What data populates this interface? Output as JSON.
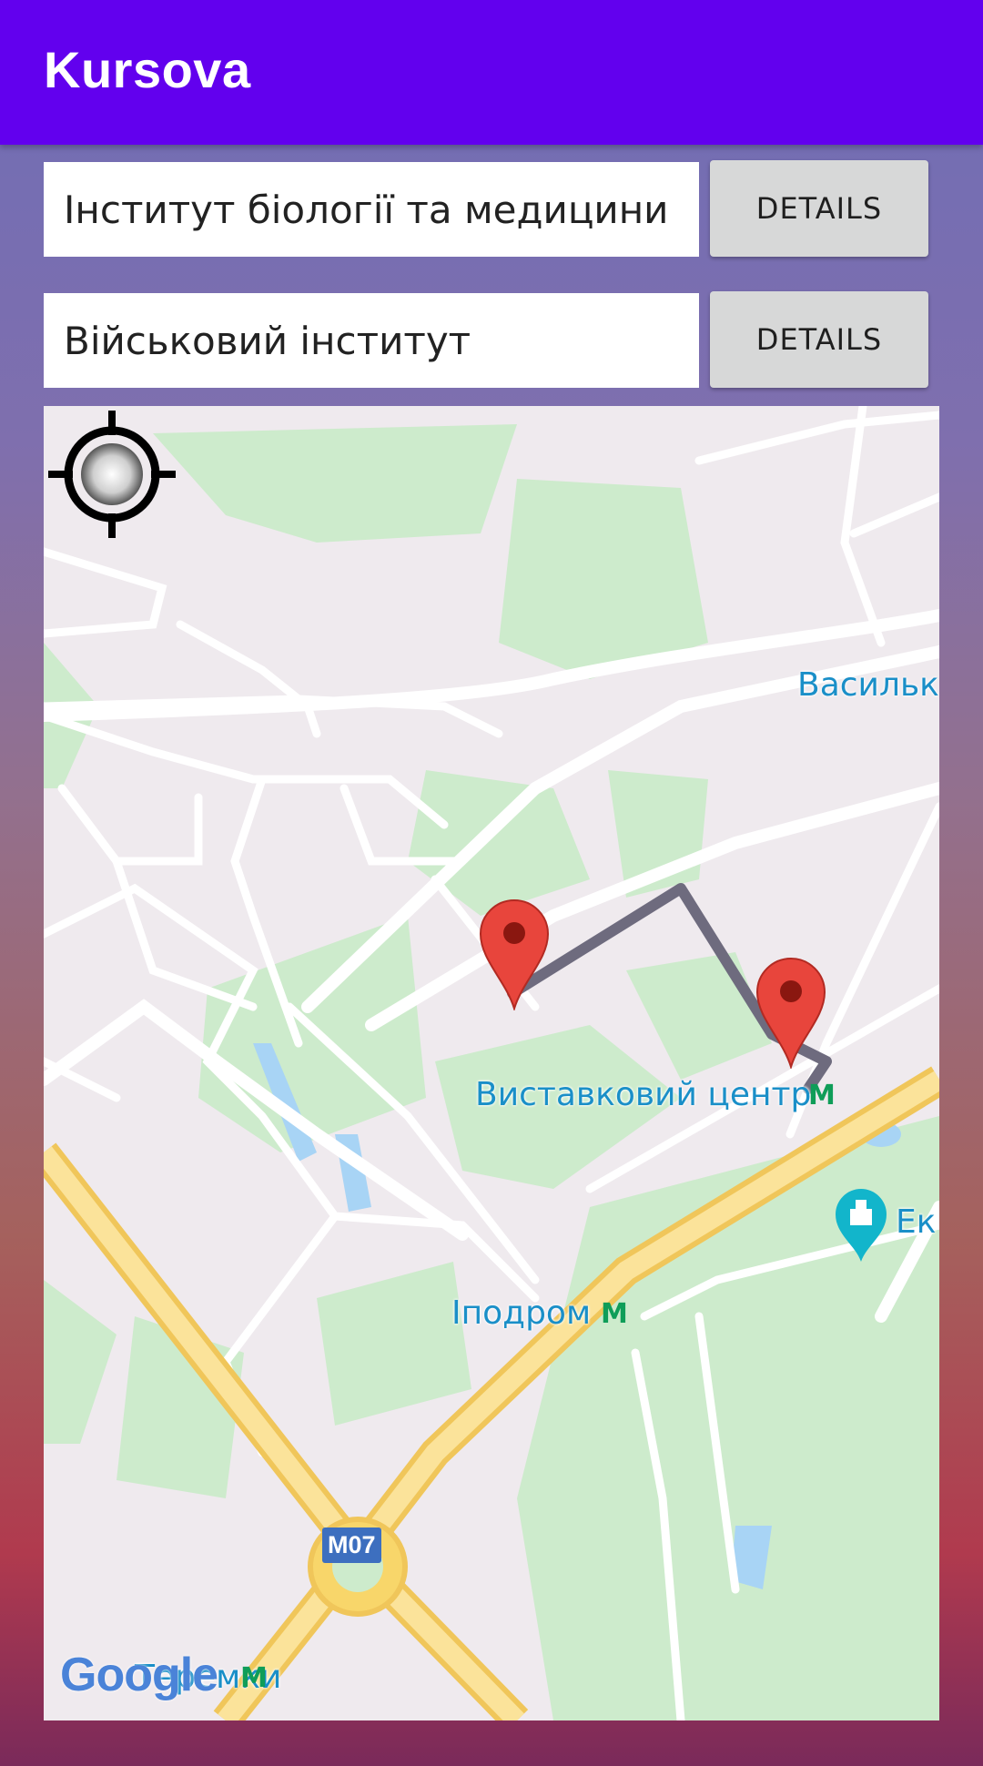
{
  "app": {
    "title": "Kursova"
  },
  "origin": {
    "value": "Інститут біології та медицини",
    "details_label": "DETAILS"
  },
  "destination": {
    "value": "Військовий інститут",
    "details_label": "DETAILS"
  },
  "map": {
    "labels": {
      "vasylkivska": "Васильківська",
      "vystavkovyi": "Виставковий центр",
      "ipodrom": "Іподром",
      "teremky": "Теремки",
      "ekspo": "Ек"
    },
    "metro_symbol": "M",
    "road_badge": "M07",
    "logo": "Google",
    "colors": {
      "pin": "#e8453c",
      "route": "#6e6b7e",
      "park": "#cdebcc",
      "highway": "#f8d66a",
      "water": "#a8d4f5"
    }
  }
}
